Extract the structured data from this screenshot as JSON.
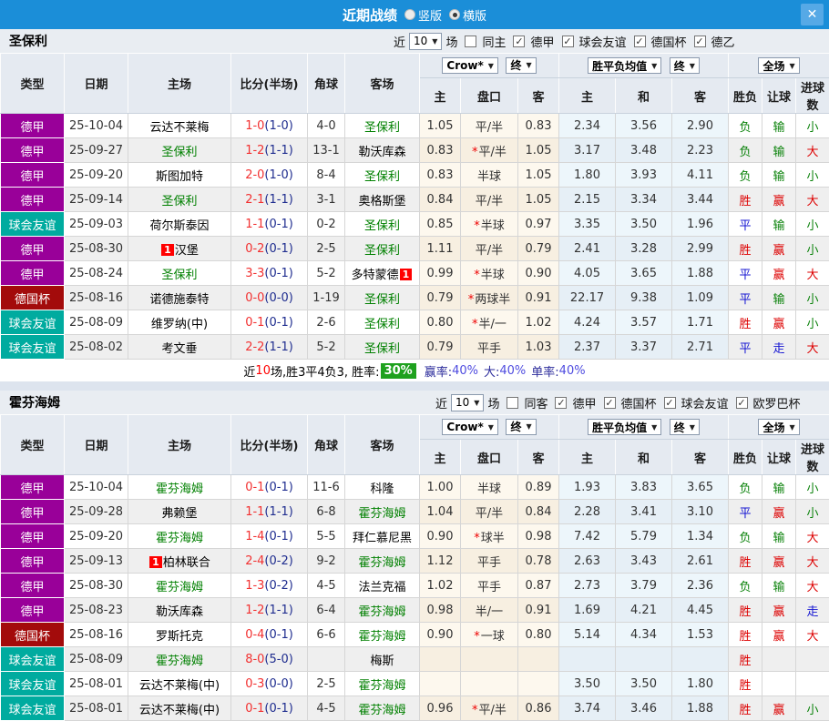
{
  "titlebar": {
    "title": "近期战绩",
    "vertical_label": "竖版",
    "horizontal_label": "横版",
    "close_glyph": "✕"
  },
  "table_header": {
    "type": "类型",
    "date": "日期",
    "home": "主场",
    "score": "比分(半场)",
    "corner": "角球",
    "away": "客场",
    "crow_select": "Crow*",
    "final_select": "终",
    "wdl_select": "胜平负均值",
    "final_select2": "终",
    "full_select": "全场",
    "sub_home": "主",
    "sub_handicap": "盘口",
    "sub_away": "客",
    "sub_home2": "主",
    "sub_draw": "和",
    "sub_away2": "客",
    "sub_result": "胜负",
    "sub_let": "让球",
    "sub_goals": "进球数"
  },
  "colors": {
    "league": {
      "德甲": "#990099",
      "球会友谊": "#00ab9f",
      "德国杯": "#a30b0b"
    },
    "focus_team": "#008000",
    "score_ft": "#f23030",
    "score_ht": "#1f2d8f",
    "win": "#dd0000",
    "push": "#1515d2",
    "lose": "#0a820a"
  },
  "sections": [
    {
      "team": "圣保利",
      "filter": {
        "near_label": "近",
        "count_value": "10",
        "games_label": "场",
        "same_label": "同主",
        "same_checked": false,
        "leagues": [
          {
            "label": "德甲",
            "checked": true
          },
          {
            "label": "球会友谊",
            "checked": true
          },
          {
            "label": "德国杯",
            "checked": true
          },
          {
            "label": "德乙",
            "checked": true
          }
        ]
      },
      "rows": [
        {
          "league": "德甲",
          "date": "25-10-04",
          "home": {
            "name": "云达不莱梅",
            "focus": false
          },
          "ft": "1-0",
          "ht": "(1-0)",
          "corners": "4-0",
          "away": {
            "name": "圣保利",
            "focus": true
          },
          "crow": {
            "home": "1.05",
            "handicap": "平/半",
            "star": false,
            "away": "0.83"
          },
          "avg": {
            "home": "2.34",
            "draw": "3.56",
            "away": "2.90"
          },
          "res": {
            "outcome": "负",
            "let": "输",
            "goals": "小"
          }
        },
        {
          "league": "德甲",
          "date": "25-09-27",
          "home": {
            "name": "圣保利",
            "focus": true
          },
          "ft": "1-2",
          "ht": "(1-1)",
          "corners": "13-1",
          "away": {
            "name": "勒沃库森",
            "focus": false
          },
          "crow": {
            "home": "0.83",
            "handicap": "平/半",
            "star": true,
            "away": "1.05"
          },
          "avg": {
            "home": "3.17",
            "draw": "3.48",
            "away": "2.23"
          },
          "res": {
            "outcome": "负",
            "let": "输",
            "goals": "大"
          }
        },
        {
          "league": "德甲",
          "date": "25-09-20",
          "home": {
            "name": "斯图加特",
            "focus": false
          },
          "ft": "2-0",
          "ht": "(1-0)",
          "corners": "8-4",
          "away": {
            "name": "圣保利",
            "focus": true
          },
          "crow": {
            "home": "0.83",
            "handicap": "半球",
            "star": false,
            "away": "1.05"
          },
          "avg": {
            "home": "1.80",
            "draw": "3.93",
            "away": "4.11"
          },
          "res": {
            "outcome": "负",
            "let": "输",
            "goals": "小"
          }
        },
        {
          "league": "德甲",
          "date": "25-09-14",
          "home": {
            "name": "圣保利",
            "focus": true
          },
          "ft": "2-1",
          "ht": "(1-1)",
          "corners": "3-1",
          "away": {
            "name": "奥格斯堡",
            "focus": false
          },
          "crow": {
            "home": "0.84",
            "handicap": "平/半",
            "star": false,
            "away": "1.05"
          },
          "avg": {
            "home": "2.15",
            "draw": "3.34",
            "away": "3.44"
          },
          "res": {
            "outcome": "胜",
            "let": "赢",
            "goals": "大"
          }
        },
        {
          "league": "球会友谊",
          "date": "25-09-03",
          "home": {
            "name": "荷尔斯泰因",
            "focus": false
          },
          "ft": "1-1",
          "ht": "(0-1)",
          "corners": "0-2",
          "away": {
            "name": "圣保利",
            "focus": true
          },
          "crow": {
            "home": "0.85",
            "handicap": "半球",
            "star": true,
            "away": "0.97"
          },
          "avg": {
            "home": "3.35",
            "draw": "3.50",
            "away": "1.96"
          },
          "res": {
            "outcome": "平",
            "let": "输",
            "goals": "小"
          }
        },
        {
          "league": "德甲",
          "date": "25-08-30",
          "home": {
            "name": "汉堡",
            "focus": false,
            "badge": "1",
            "badge_pos": "before"
          },
          "ft": "0-2",
          "ht": "(0-1)",
          "corners": "2-5",
          "away": {
            "name": "圣保利",
            "focus": true
          },
          "crow": {
            "home": "1.11",
            "handicap": "平/半",
            "star": false,
            "away": "0.79"
          },
          "avg": {
            "home": "2.41",
            "draw": "3.28",
            "away": "2.99"
          },
          "res": {
            "outcome": "胜",
            "let": "赢",
            "goals": "小"
          }
        },
        {
          "league": "德甲",
          "date": "25-08-24",
          "home": {
            "name": "圣保利",
            "focus": true
          },
          "ft": "3-3",
          "ht": "(0-1)",
          "corners": "5-2",
          "away": {
            "name": "多特蒙德",
            "focus": false,
            "badge": "1",
            "badge_pos": "after"
          },
          "crow": {
            "home": "0.99",
            "handicap": "半球",
            "star": true,
            "away": "0.90"
          },
          "avg": {
            "home": "4.05",
            "draw": "3.65",
            "away": "1.88"
          },
          "res": {
            "outcome": "平",
            "let": "赢",
            "goals": "大"
          }
        },
        {
          "league": "德国杯",
          "date": "25-08-16",
          "home": {
            "name": "诺德施泰特",
            "focus": false
          },
          "ft": "0-0",
          "ht": "(0-0)",
          "corners": "1-19",
          "away": {
            "name": "圣保利",
            "focus": true
          },
          "crow": {
            "home": "0.79",
            "handicap": "两球半",
            "star": true,
            "away": "0.91"
          },
          "avg": {
            "home": "22.17",
            "draw": "9.38",
            "away": "1.09"
          },
          "res": {
            "outcome": "平",
            "let": "输",
            "goals": "小"
          }
        },
        {
          "league": "球会友谊",
          "date": "25-08-09",
          "home": {
            "name": "维罗纳(中)",
            "focus": false
          },
          "ft": "0-1",
          "ht": "(0-1)",
          "corners": "2-6",
          "away": {
            "name": "圣保利",
            "focus": true
          },
          "crow": {
            "home": "0.80",
            "handicap": "半/一",
            "star": true,
            "away": "1.02"
          },
          "avg": {
            "home": "4.24",
            "draw": "3.57",
            "away": "1.71"
          },
          "res": {
            "outcome": "胜",
            "let": "赢",
            "goals": "小"
          }
        },
        {
          "league": "球会友谊",
          "date": "25-08-02",
          "home": {
            "name": "考文垂",
            "focus": false
          },
          "ft": "2-2",
          "ht": "(1-1)",
          "corners": "5-2",
          "away": {
            "name": "圣保利",
            "focus": true
          },
          "crow": {
            "home": "0.79",
            "handicap": "平手",
            "star": false,
            "away": "1.03"
          },
          "avg": {
            "home": "2.37",
            "draw": "3.37",
            "away": "2.71"
          },
          "res": {
            "outcome": "平",
            "let": "走",
            "goals": "大"
          }
        }
      ],
      "summary": {
        "near": "近",
        "count": "10",
        "text": "场,胜3平4负3, 胜率:",
        "win_rate": "30%",
        "stats": [
          {
            "label": "赢率:",
            "value": "40%"
          },
          {
            "label": "大:",
            "value": "40%"
          },
          {
            "label": "单率:",
            "value": "40%"
          }
        ]
      }
    },
    {
      "team": "霍芬海姆",
      "filter": {
        "near_label": "近",
        "count_value": "10",
        "games_label": "场",
        "same_label": "同客",
        "same_checked": false,
        "leagues": [
          {
            "label": "德甲",
            "checked": true
          },
          {
            "label": "德国杯",
            "checked": true
          },
          {
            "label": "球会友谊",
            "checked": true
          },
          {
            "label": "欧罗巴杯",
            "checked": true
          }
        ]
      },
      "rows": [
        {
          "league": "德甲",
          "date": "25-10-04",
          "home": {
            "name": "霍芬海姆",
            "focus": true
          },
          "ft": "0-1",
          "ht": "(0-1)",
          "corners": "11-6",
          "away": {
            "name": "科隆",
            "focus": false
          },
          "crow": {
            "home": "1.00",
            "handicap": "半球",
            "star": false,
            "away": "0.89"
          },
          "avg": {
            "home": "1.93",
            "draw": "3.83",
            "away": "3.65"
          },
          "res": {
            "outcome": "负",
            "let": "输",
            "goals": "小"
          }
        },
        {
          "league": "德甲",
          "date": "25-09-28",
          "home": {
            "name": "弗赖堡",
            "focus": false
          },
          "ft": "1-1",
          "ht": "(1-1)",
          "corners": "6-8",
          "away": {
            "name": "霍芬海姆",
            "focus": true
          },
          "crow": {
            "home": "1.04",
            "handicap": "平/半",
            "star": false,
            "away": "0.84"
          },
          "avg": {
            "home": "2.28",
            "draw": "3.41",
            "away": "3.10"
          },
          "res": {
            "outcome": "平",
            "let": "赢",
            "goals": "小"
          }
        },
        {
          "league": "德甲",
          "date": "25-09-20",
          "home": {
            "name": "霍芬海姆",
            "focus": true
          },
          "ft": "1-4",
          "ht": "(0-1)",
          "corners": "5-5",
          "away": {
            "name": "拜仁慕尼黑",
            "focus": false
          },
          "crow": {
            "home": "0.90",
            "handicap": "球半",
            "star": true,
            "away": "0.98"
          },
          "avg": {
            "home": "7.42",
            "draw": "5.79",
            "away": "1.34"
          },
          "res": {
            "outcome": "负",
            "let": "输",
            "goals": "大"
          }
        },
        {
          "league": "德甲",
          "date": "25-09-13",
          "home": {
            "name": "柏林联合",
            "focus": false,
            "badge": "1",
            "badge_pos": "before"
          },
          "ft": "2-4",
          "ht": "(0-2)",
          "corners": "9-2",
          "away": {
            "name": "霍芬海姆",
            "focus": true
          },
          "crow": {
            "home": "1.12",
            "handicap": "平手",
            "star": false,
            "away": "0.78"
          },
          "avg": {
            "home": "2.63",
            "draw": "3.43",
            "away": "2.61"
          },
          "res": {
            "outcome": "胜",
            "let": "赢",
            "goals": "大"
          }
        },
        {
          "league": "德甲",
          "date": "25-08-30",
          "home": {
            "name": "霍芬海姆",
            "focus": true
          },
          "ft": "1-3",
          "ht": "(0-2)",
          "corners": "4-5",
          "away": {
            "name": "法兰克福",
            "focus": false
          },
          "crow": {
            "home": "1.02",
            "handicap": "平手",
            "star": false,
            "away": "0.87"
          },
          "avg": {
            "home": "2.73",
            "draw": "3.79",
            "away": "2.36"
          },
          "res": {
            "outcome": "负",
            "let": "输",
            "goals": "大"
          }
        },
        {
          "league": "德甲",
          "date": "25-08-23",
          "home": {
            "name": "勒沃库森",
            "focus": false
          },
          "ft": "1-2",
          "ht": "(1-1)",
          "corners": "6-4",
          "away": {
            "name": "霍芬海姆",
            "focus": true
          },
          "crow": {
            "home": "0.98",
            "handicap": "半/一",
            "star": false,
            "away": "0.91"
          },
          "avg": {
            "home": "1.69",
            "draw": "4.21",
            "away": "4.45"
          },
          "res": {
            "outcome": "胜",
            "let": "赢",
            "goals": "走"
          }
        },
        {
          "league": "德国杯",
          "date": "25-08-16",
          "home": {
            "name": "罗斯托克",
            "focus": false
          },
          "ft": "0-4",
          "ht": "(0-1)",
          "corners": "6-6",
          "away": {
            "name": "霍芬海姆",
            "focus": true
          },
          "crow": {
            "home": "0.90",
            "handicap": "一球",
            "star": true,
            "away": "0.80"
          },
          "avg": {
            "home": "5.14",
            "draw": "4.34",
            "away": "1.53"
          },
          "res": {
            "outcome": "胜",
            "let": "赢",
            "goals": "大"
          }
        },
        {
          "league": "球会友谊",
          "date": "25-08-09",
          "home": {
            "name": "霍芬海姆",
            "focus": true
          },
          "ft": "8-0",
          "ht": "(5-0)",
          "corners": "",
          "away": {
            "name": "梅斯",
            "focus": false
          },
          "crow": {
            "home": "",
            "handicap": "",
            "star": false,
            "away": ""
          },
          "avg": {
            "home": "",
            "draw": "",
            "away": ""
          },
          "res": {
            "outcome": "胜",
            "let": "",
            "goals": ""
          }
        },
        {
          "league": "球会友谊",
          "date": "25-08-01",
          "home": {
            "name": "云达不莱梅(中)",
            "focus": false
          },
          "ft": "0-3",
          "ht": "(0-0)",
          "corners": "2-5",
          "away": {
            "name": "霍芬海姆",
            "focus": true
          },
          "crow": {
            "home": "",
            "handicap": "",
            "star": false,
            "away": ""
          },
          "avg": {
            "home": "3.50",
            "draw": "3.50",
            "away": "1.80"
          },
          "res": {
            "outcome": "胜",
            "let": "",
            "goals": ""
          }
        },
        {
          "league": "球会友谊",
          "date": "25-08-01",
          "home": {
            "name": "云达不莱梅(中)",
            "focus": false
          },
          "ft": "0-1",
          "ht": "(0-1)",
          "corners": "4-5",
          "away": {
            "name": "霍芬海姆",
            "focus": true
          },
          "crow": {
            "home": "0.96",
            "handicap": "平/半",
            "star": true,
            "away": "0.86"
          },
          "avg": {
            "home": "3.74",
            "draw": "3.46",
            "away": "1.88"
          },
          "res": {
            "outcome": "胜",
            "let": "赢",
            "goals": "小"
          }
        }
      ]
    }
  ]
}
